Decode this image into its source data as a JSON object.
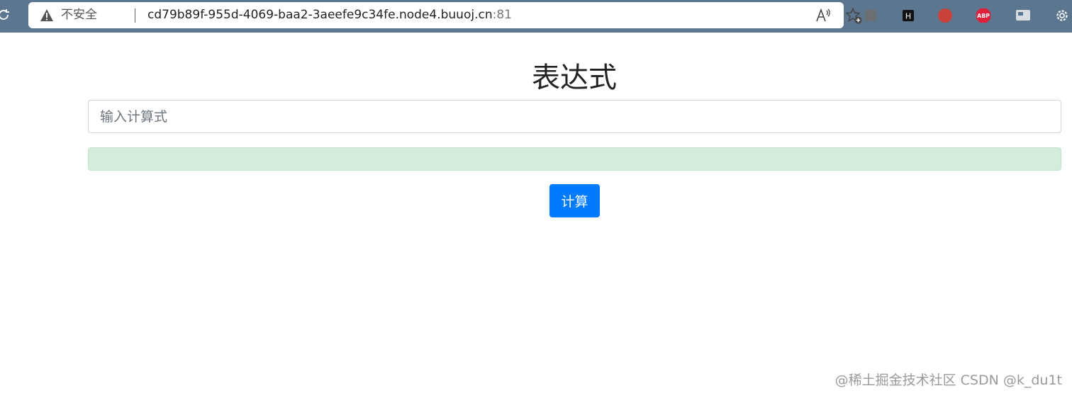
{
  "browser": {
    "security_label": "不安全",
    "url_host": "cd79b89f-955d-4069-baa2-3aeefe9c34fe.node4.buuoj.cn",
    "url_port": ":81",
    "extensions": [
      "extension-icon",
      "h-extension-icon",
      "red-extension-icon",
      "ABP",
      "screen-extension-icon",
      "settings-icon"
    ]
  },
  "page": {
    "title": "表达式",
    "input_placeholder": "输入计算式",
    "input_value": "",
    "result_text": "",
    "button_label": "计算"
  },
  "watermark": "@稀土掘金技术社区 CSDN @k_du1t",
  "colors": {
    "chrome": "#5d7690",
    "button": "#007bff",
    "result_bg": "#d4edda"
  }
}
